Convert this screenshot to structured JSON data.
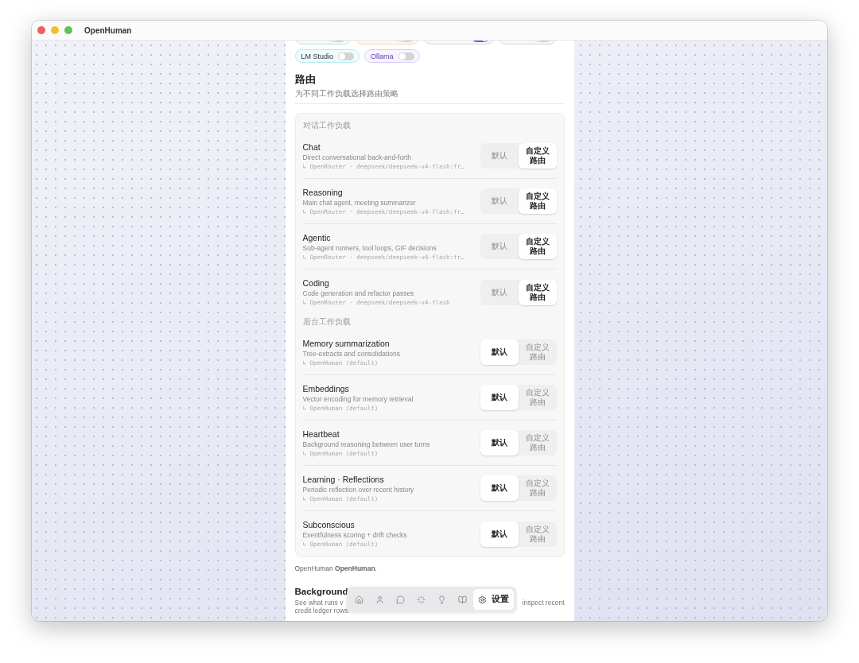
{
  "window": {
    "title": "OpenHuman"
  },
  "providers": [
    {
      "on": false,
      "color": "#bfe9cd"
    },
    {
      "on": false,
      "color": "#f3d6b8"
    },
    {
      "on": true,
      "color": "#d6d8de"
    },
    {
      "on": false,
      "color": "#d6d8de"
    },
    {
      "label": "LM Studio",
      "on": false,
      "color": "#b6e9f0"
    },
    {
      "label": "Ollama",
      "on": false,
      "color": "#d8cdf3"
    }
  ],
  "routing": {
    "title": "路由",
    "subtitle": "为不同工作负载选择路由策略",
    "groups": [
      {
        "label": "对话工作负载",
        "workloads": [
          {
            "name": "Chat",
            "description": "Direct conversational back-and-forth",
            "route": "↳ OpenRouter · deepseek/deepseek-v4-flash:fr…",
            "options": [
              {
                "label": "默认",
                "selected": false
              },
              {
                "label": "自定义路由",
                "selected": true
              }
            ]
          },
          {
            "name": "Reasoning",
            "description": "Main chat agent, meeting summarizer",
            "route": "↳ OpenRouter · deepseek/deepseek-v4-flash:fr…",
            "options": [
              {
                "label": "默认",
                "selected": false
              },
              {
                "label": "自定义路由",
                "selected": true
              }
            ]
          },
          {
            "name": "Agentic",
            "description": "Sub-agent runners, tool loops, GIF decisions",
            "route": "↳ OpenRouter · deepseek/deepseek-v4-flash:fr…",
            "options": [
              {
                "label": "默认",
                "selected": false
              },
              {
                "label": "自定义路由",
                "selected": true
              }
            ]
          },
          {
            "name": "Coding",
            "description": "Code generation and refactor passes",
            "route": "↳ OpenRouter · deepseek/deepseek-v4-flash",
            "options": [
              {
                "label": "默认",
                "selected": false
              },
              {
                "label": "自定义路由",
                "selected": true
              }
            ]
          }
        ]
      },
      {
        "label": "后台工作负载",
        "workloads": [
          {
            "name": "Memory summarization",
            "description": "Tree-extracts and consolidations",
            "route": "↳ OpenHuman (default)",
            "options": [
              {
                "label": "默认",
                "selected": true
              },
              {
                "label": "自定义路由",
                "selected": false
              }
            ]
          },
          {
            "name": "Embeddings",
            "description": "Vector encoding for memory retrieval",
            "route": "↳ OpenHuman (default)",
            "options": [
              {
                "label": "默认",
                "selected": true
              },
              {
                "label": "自定义路由",
                "selected": false
              }
            ]
          },
          {
            "name": "Heartbeat",
            "description": "Background reasoning between user turns",
            "route": "↳ OpenHuman (default)",
            "options": [
              {
                "label": "默认",
                "selected": true
              },
              {
                "label": "自定义路由",
                "selected": false
              }
            ]
          },
          {
            "name": "Learning · Reflections",
            "description": "Periodic reflection over recent history",
            "route": "↳ OpenHuman (default)",
            "options": [
              {
                "label": "默认",
                "selected": true
              },
              {
                "label": "自定义路由",
                "selected": false
              }
            ]
          },
          {
            "name": "Subconscious",
            "description": "Eventfulness scoring + drift checks",
            "route": "↳ OpenHuman (default)",
            "options": [
              {
                "label": "默认",
                "selected": true
              },
              {
                "label": "自定义路由",
                "selected": false
              }
            ]
          }
        ]
      }
    ],
    "note": "OpenHuman **OpenHuman**."
  },
  "background": {
    "title": "Background",
    "description_start": "See what runs v",
    "description_end": "inspect recent",
    "description_line_2": "credit ledger rows."
  },
  "nav": [
    {
      "kind": "home",
      "selected": false
    },
    {
      "kind": "user",
      "selected": false
    },
    {
      "kind": "chat",
      "selected": false
    },
    {
      "kind": "loader",
      "selected": false
    },
    {
      "kind": "idea",
      "selected": false
    },
    {
      "kind": "book",
      "selected": false
    },
    {
      "kind": "settings",
      "label": "设置",
      "selected": true
    }
  ]
}
